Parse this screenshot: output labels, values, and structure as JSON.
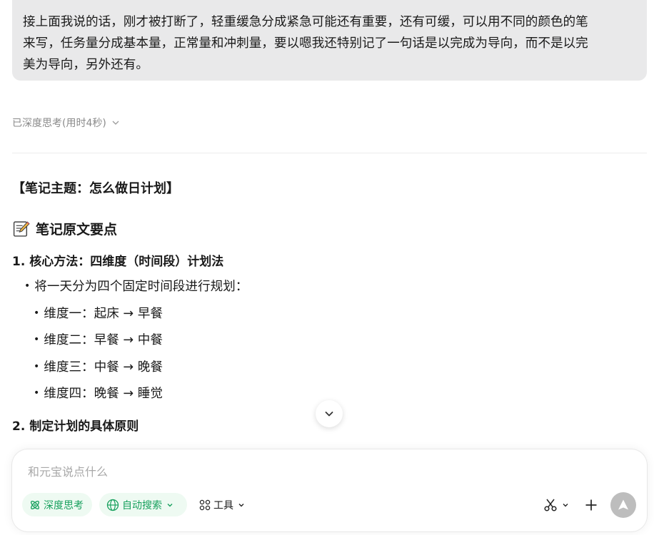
{
  "user_message": {
    "line1": "接上面我说的话，刚才被打断了，轻重缓急分成紧急可能还有重要，还有可缓，可以用不同的颜色的笔",
    "line2": "来写，任务量分成基本量，正常量和冲刺量，要以嗯我还特别记了一句话是以完成为导向，而不是以完",
    "line3": "美为导向，另外还有。"
  },
  "reasoning": {
    "label": "已深度思考(用时4秒)"
  },
  "answer": {
    "title": "【笔记主题：怎么做日计划】",
    "section_heading": "笔记原文要点",
    "point1": {
      "heading": "1. 核心方法：四维度（时间段）计划法",
      "intro": "将一天分为四个固定时间段进行规划：",
      "items": [
        "维度一：起床 → 早餐",
        "维度二：早餐 → 中餐",
        "维度三：中餐 → 晚餐",
        "维度四：晚餐 → 睡觉"
      ]
    },
    "point2": {
      "heading": "2. 制定计划的具体原则"
    }
  },
  "composer": {
    "placeholder": "和元宝说点什么",
    "value": "",
    "deep_think_label": "深度思考",
    "auto_search_label": "自动搜索",
    "tools_label": "工具"
  },
  "colors": {
    "accent_green": "#17a05d",
    "pill_bg": "#eefaf2",
    "bubble_bg": "#e9e9ea",
    "send_disabled": "#bdbdbd"
  },
  "icons": {
    "reasoning_toggle": "chevron-down-icon",
    "section": "memo-icon",
    "scroll": "chevron-down-icon",
    "deep_think": "atom-icon",
    "auto_search": "globe-icon",
    "tools": "grid-icon",
    "scissors": "scissors-icon",
    "new_chat": "plus-icon",
    "send": "send-icon"
  }
}
